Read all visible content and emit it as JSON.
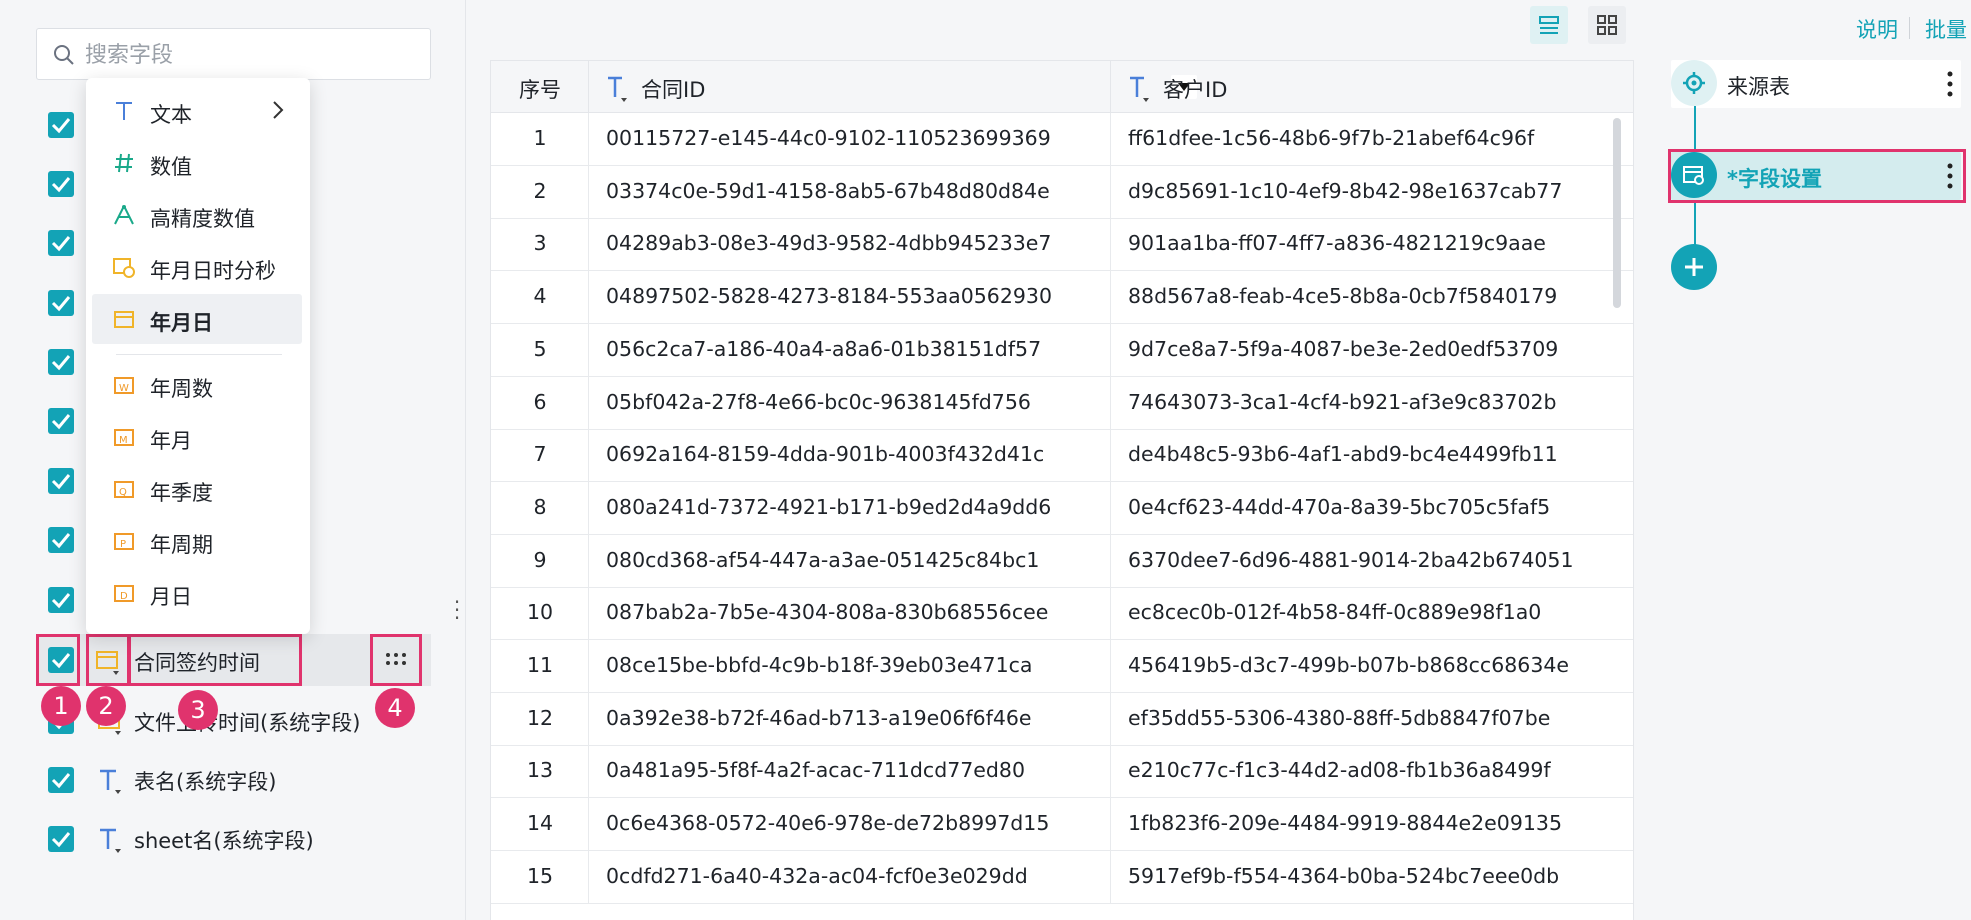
{
  "search": {
    "placeholder": "搜索字段"
  },
  "type_menu": {
    "items": [
      {
        "label": "文本",
        "icon": "text-type-icon",
        "has_submenu": true
      },
      {
        "label": "数值",
        "icon": "number-type-icon"
      },
      {
        "label": "高精度数值",
        "icon": "high-precision-number-icon"
      },
      {
        "label": "年月日时分秒",
        "icon": "datetime-icon"
      },
      {
        "label": "年月日",
        "icon": "date-icon",
        "selected": true
      },
      {
        "label": "年周数",
        "icon": "year-week-icon"
      },
      {
        "label": "年月",
        "icon": "year-month-icon"
      },
      {
        "label": "年季度",
        "icon": "year-quarter-icon"
      },
      {
        "label": "年周期",
        "icon": "year-period-icon"
      },
      {
        "label": "月日",
        "icon": "month-day-icon"
      }
    ]
  },
  "fields": {
    "active": {
      "label": "合同签约时间",
      "checked": true
    },
    "items": [
      {
        "label": "文件上传时间(系统字段)",
        "checked": true
      },
      {
        "label": "表名(系统字段)",
        "checked": true
      },
      {
        "label": "sheet名(系统字段)",
        "checked": true
      }
    ]
  },
  "annotations": [
    "1",
    "2",
    "3",
    "4"
  ],
  "table": {
    "headers": [
      "序号",
      "合同ID",
      "客户ID"
    ],
    "rows": [
      [
        "1",
        "00115727-e145-44c0-9102-110523699369",
        "ff61dfee-1c56-48b6-9f7b-21abef64c96f"
      ],
      [
        "2",
        "03374c0e-59d1-4158-8ab5-67b48d80d84e",
        "d9c85691-1c10-4ef9-8b42-98e1637cab77"
      ],
      [
        "3",
        "04289ab3-08e3-49d3-9582-4dbb945233e7",
        "901aa1ba-ff07-4ff7-a836-4821219c9aae"
      ],
      [
        "4",
        "04897502-5828-4273-8184-553aa0562930",
        "88d567a8-feab-4ce5-8b8a-0cb7f5840179"
      ],
      [
        "5",
        "056c2ca7-a186-40a4-a8a6-01b38151df57",
        "9d7ce8a7-5f9a-4087-be3e-2ed0edf53709"
      ],
      [
        "6",
        "05bf042a-27f8-4e66-bc0c-9638145fd756",
        "74643073-3ca1-4cf4-b921-af3e9c83702b"
      ],
      [
        "7",
        "0692a164-8159-4dda-901b-4003f432d41c",
        "de4b48c5-93b6-4af1-abd9-bc4e4499fb11"
      ],
      [
        "8",
        "080a241d-7372-4921-b171-b9ed2d4a9dd6",
        "0e4cf623-44dd-470a-8a39-5bc705c5faf5"
      ],
      [
        "9",
        "080cd368-af54-447a-a3ae-051425c84bc1",
        "6370dee7-6d96-4881-9014-2ba42b674051"
      ],
      [
        "10",
        "087bab2a-7b5e-4304-808a-830b68556cee",
        "ec8cec0b-012f-4b58-84ff-0c889e98f1a0"
      ],
      [
        "11",
        "08ce15be-bbfd-4c9b-b18f-39eb03e471ca",
        "456419b5-d3c7-499b-b07b-b868cc68634e"
      ],
      [
        "12",
        "0a392e38-b72f-46ad-b713-a19e06f6f46e",
        "ef35dd55-5306-4380-88ff-5db8847f07be"
      ],
      [
        "13",
        "0a481a95-5f8f-4a2f-acac-711dcd77ed80",
        "e210c77c-f1c3-44d2-ad08-fb1b36a8499f"
      ],
      [
        "14",
        "0c6e4368-0572-40e6-978e-de72b8997d15",
        "1fb823f6-209e-4484-9919-8844e2e09135"
      ],
      [
        "15",
        "0cdfd271-6a40-432a-ac04-fcf0e3e029dd",
        "5917ef9b-f554-4364-b0ba-524bc7eee0db"
      ]
    ]
  },
  "right_panel": {
    "links": [
      "说明",
      "批量"
    ],
    "nodes": [
      {
        "label": "来源表",
        "icon": "source-table-icon"
      },
      {
        "label": "*字段设置",
        "icon": "field-settings-icon",
        "active": true
      }
    ]
  },
  "colors": {
    "accent": "#13a3b6",
    "highlight": "#e0336d",
    "date_icon": "#f0b429",
    "text_icon": "#4a7fd9"
  }
}
